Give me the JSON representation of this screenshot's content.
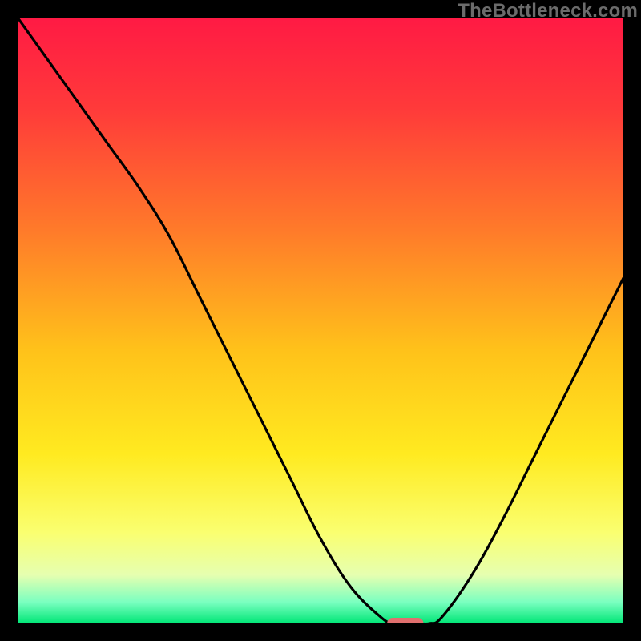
{
  "watermark": "TheBottleneck.com",
  "chart_data": {
    "type": "line",
    "title": "",
    "xlabel": "",
    "ylabel": "",
    "xlim": [
      0,
      100
    ],
    "ylim": [
      0,
      100
    ],
    "grid": false,
    "series": [
      {
        "name": "bottleneck-curve",
        "x": [
          0,
          5,
          10,
          15,
          20,
          25,
          30,
          35,
          40,
          45,
          50,
          55,
          60,
          62,
          64,
          66,
          68,
          70,
          75,
          80,
          85,
          90,
          95,
          100
        ],
        "values": [
          100,
          93,
          86,
          79,
          72,
          64,
          54,
          44,
          34,
          24,
          14,
          6,
          1,
          0,
          0,
          0,
          0,
          1,
          8,
          17,
          27,
          37,
          47,
          57
        ]
      }
    ],
    "annotations": [
      {
        "name": "optimal-marker",
        "x_range": [
          61,
          67
        ],
        "y": 0
      }
    ],
    "background_gradient": {
      "stops": [
        {
          "offset": 0.0,
          "color": "#ff1a44"
        },
        {
          "offset": 0.15,
          "color": "#ff3a3a"
        },
        {
          "offset": 0.35,
          "color": "#ff7a2a"
        },
        {
          "offset": 0.55,
          "color": "#ffc21a"
        },
        {
          "offset": 0.72,
          "color": "#ffea20"
        },
        {
          "offset": 0.85,
          "color": "#faff70"
        },
        {
          "offset": 0.92,
          "color": "#e6ffb0"
        },
        {
          "offset": 0.965,
          "color": "#7affc0"
        },
        {
          "offset": 1.0,
          "color": "#00e676"
        }
      ]
    },
    "marker_style": {
      "color": "#e1706f",
      "radius_px": 7
    }
  }
}
